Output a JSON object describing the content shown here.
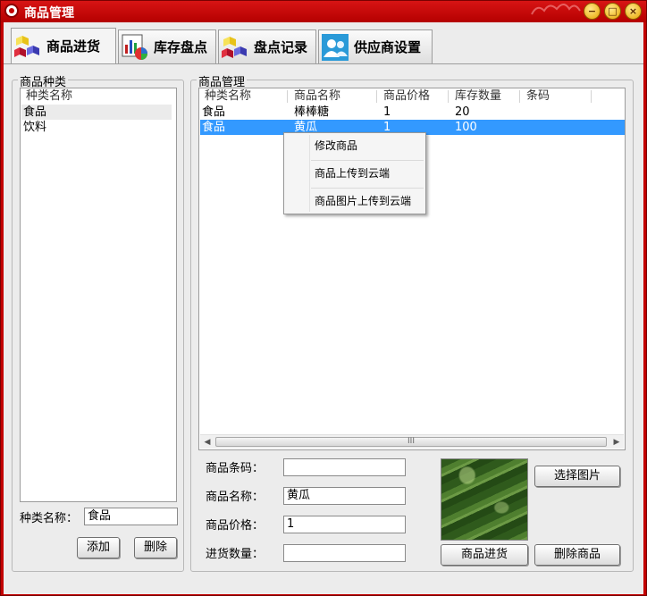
{
  "window": {
    "title": "商品管理"
  },
  "tabs": [
    {
      "label": "商品进货",
      "icon": "cubes-icon",
      "active": true
    },
    {
      "label": "库存盘点",
      "icon": "chart-icon",
      "active": false
    },
    {
      "label": "盘点记录",
      "icon": "cubes-icon",
      "active": false
    },
    {
      "label": "供应商设置",
      "icon": "users-icon",
      "active": false
    }
  ],
  "category_panel": {
    "title": "商品种类",
    "column_header": "种类名称",
    "items": [
      "食品",
      "饮料"
    ],
    "name_label": "种类名称：",
    "name_value": "食品",
    "add_label": "添加",
    "delete_label": "删除"
  },
  "goods_panel": {
    "title": "商品管理",
    "columns": [
      "种类名称",
      "商品名称",
      "商品价格",
      "库存数量",
      "条码"
    ],
    "rows": [
      [
        "食品",
        "棒棒糖",
        "1",
        "20",
        ""
      ],
      [
        "食品",
        "黄瓜",
        "1",
        "100",
        ""
      ]
    ],
    "selected_row": 1,
    "scroll_grip": "III"
  },
  "context_menu": {
    "items": [
      "修改商品",
      "商品上传到云端",
      "商品图片上传到云端"
    ]
  },
  "form": {
    "barcode_label": "商品条码：",
    "barcode_value": "",
    "name_label": "商品名称：",
    "name_value": "黄瓜",
    "price_label": "商品价格：",
    "price_value": "1",
    "qty_label": "进货数量：",
    "qty_value": "",
    "choose_image_label": "选择图片",
    "purchase_label": "商品进货",
    "delete_label": "删除商品"
  },
  "colors": {
    "title_bar": "#c20000",
    "selection": "#3399ff",
    "client_bg": "#ececec"
  }
}
